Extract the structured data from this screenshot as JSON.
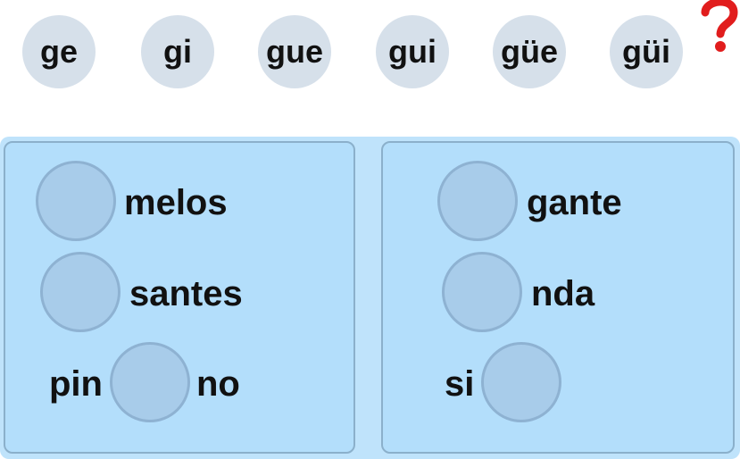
{
  "syllables": [
    {
      "label": "ge"
    },
    {
      "label": "gi"
    },
    {
      "label": "gue"
    },
    {
      "label": "gui"
    },
    {
      "label": "güe"
    },
    {
      "label": "güi"
    }
  ],
  "help": {
    "icon": "question-mark-icon",
    "color": "#e11d1d"
  },
  "colors": {
    "chip": "#d6e0ea",
    "board": "#bfe3fb",
    "panel": "#b3defb",
    "slot": "#a8ccea"
  },
  "left_panel": {
    "items": [
      {
        "after": "melos"
      },
      {
        "after": "santes"
      },
      {
        "before": "pin",
        "after": "no"
      }
    ]
  },
  "right_panel": {
    "items": [
      {
        "after": "gante"
      },
      {
        "after": "nda"
      },
      {
        "before": "si"
      }
    ]
  }
}
